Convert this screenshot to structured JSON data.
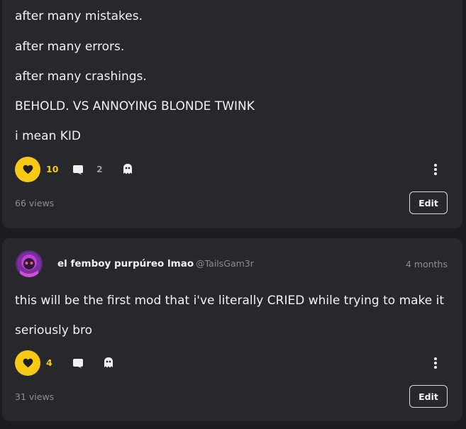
{
  "posts": [
    {
      "lines": [
        "after many mistakes.",
        "after many errors.",
        "after many crashings.",
        "BEHOLD. VS ANNOYING BLONDE TWINK",
        "i mean KID"
      ],
      "likes": "10",
      "comments": "2",
      "views": "66 views",
      "edit_label": "Edit"
    },
    {
      "author_name": "el femboy purpúreo lmao",
      "author_handle": "@TailsGam3r",
      "timestamp": "4 months",
      "lines": [
        "this will be the first mod that i've literally CRIED while trying to make it",
        "seriously bro"
      ],
      "likes": "4",
      "views": "31 views",
      "edit_label": "Edit"
    }
  ],
  "colors": {
    "accent": "#f6c917",
    "card": "#27282c",
    "background": "#1b1c1f"
  },
  "icons": [
    "heart-icon",
    "comment-icon",
    "ghost-icon",
    "more-vertical-icon",
    "avatar"
  ]
}
